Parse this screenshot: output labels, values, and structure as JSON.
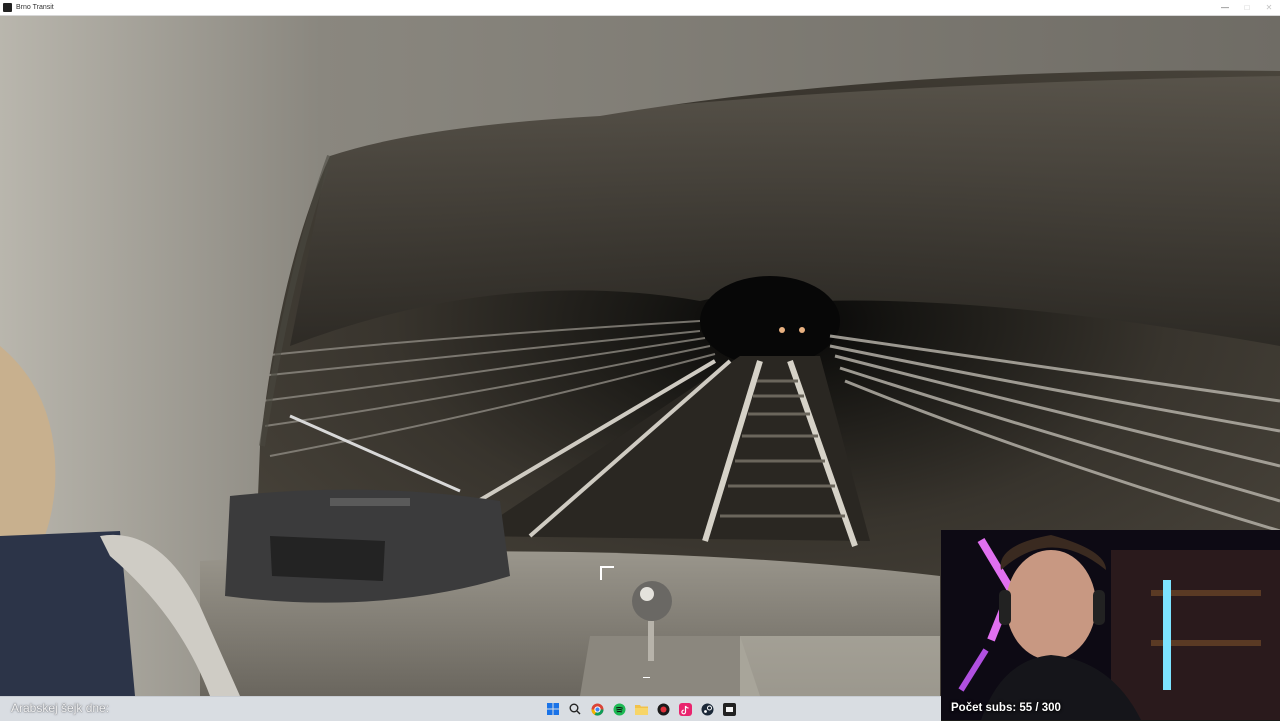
{
  "window": {
    "title": "Brno Transit",
    "controls": {
      "minimize": "—",
      "maximize": "□",
      "close": "✕"
    }
  },
  "overlay": {
    "ticker_text": "Arabskej šejk dne:",
    "subs_label": "Počet subs:",
    "subs_current": 55,
    "subs_goal": 300,
    "subs_text": "Počet subs: 55 / 300"
  },
  "taskbar": {
    "icons": [
      "windows-start-icon",
      "search-icon",
      "chrome-icon",
      "spotify-icon",
      "file-explorer-icon",
      "app-icon",
      "tiktok-icon",
      "steam-icon",
      "game-icon"
    ]
  },
  "colors": {
    "taskbar_bg": "#d9dde2",
    "tunnel_wall": "#3f3b35",
    "tunnel_light": "#d8a070"
  }
}
